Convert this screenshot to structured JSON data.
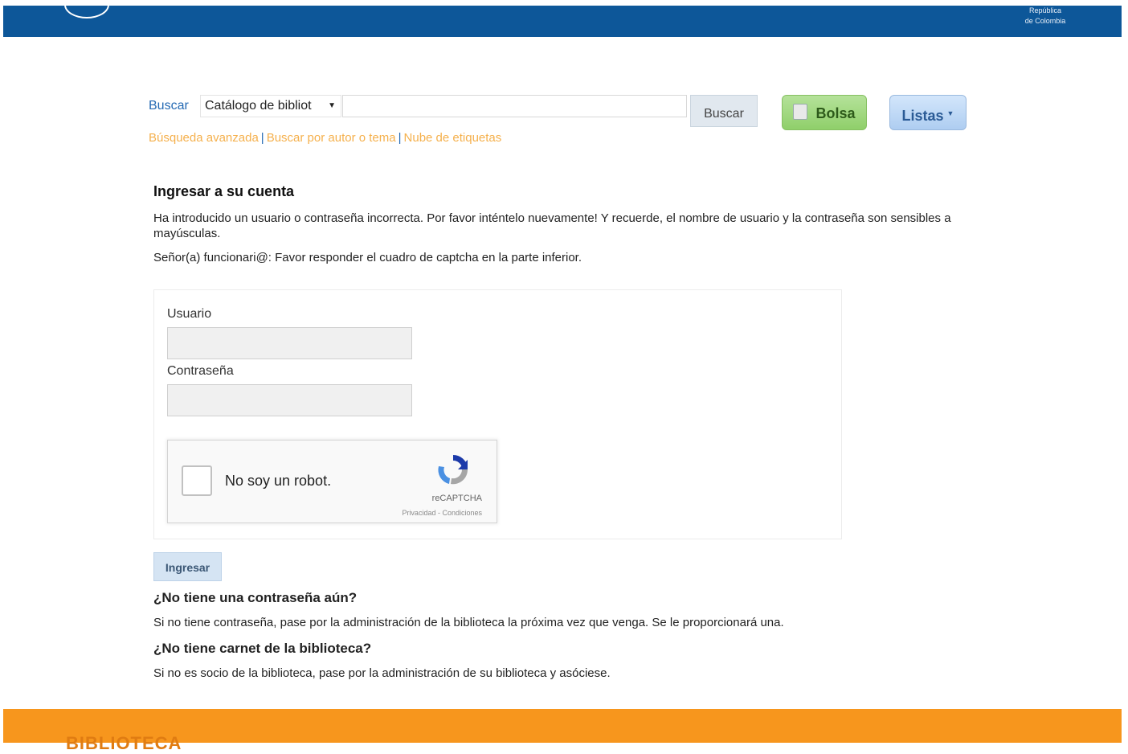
{
  "header": {
    "country_line1": "República",
    "country_line2": "de Colombia"
  },
  "search": {
    "label": "Buscar",
    "catalog_selected": "Catálogo de bibliot",
    "query_value": "",
    "button_label": "Buscar",
    "links": [
      "Búsqueda avanzada",
      "Buscar por autor o tema",
      "Nube de etiquetas"
    ],
    "separator": "|"
  },
  "nav": {
    "bolsa_label": "Bolsa",
    "listas_label": "Listas"
  },
  "login": {
    "title": "Ingresar a su cuenta",
    "error_message": "Ha introducido un usuario o contraseña incorrecta. Por favor inténtelo nuevamente! Y recuerde, el nombre de usuario y la contraseña son sensibles a mayúsculas.",
    "captcha_note": "Señor(a) funcionari@: Favor responder el cuadro de captcha en la parte inferior.",
    "user_label": "Usuario",
    "user_value": "",
    "password_label": "Contraseña",
    "password_value": "",
    "recaptcha_label": "No soy un robot.",
    "recaptcha_brand": "reCAPTCHA",
    "recaptcha_terms": "Privacidad - Condiciones",
    "submit_label": "Ingresar"
  },
  "help": {
    "no_password_title": "¿No tiene una contraseña aún?",
    "no_password_text": "Si no tiene contraseña, pase por la administración de la biblioteca la próxima vez que venga. Se le proporcionará una.",
    "no_card_title": "¿No tiene carnet de la biblioteca?",
    "no_card_text": "Si no es socio de la biblioteca, pase por la administración de su biblioteca y asóciese."
  },
  "footer": {
    "text": "BIBLIOTECA"
  },
  "colors": {
    "header_blue": "#0d5799",
    "link_orange": "#f5b04c",
    "footer_orange": "#f7961d",
    "bolsa_green": "#8fcf6a",
    "listas_blue": "#aecdf1"
  },
  "icons": {
    "bolsa": "shopping-bag-icon",
    "listas": "caret-down-icon",
    "recaptcha": "recaptcha-logo-icon"
  }
}
